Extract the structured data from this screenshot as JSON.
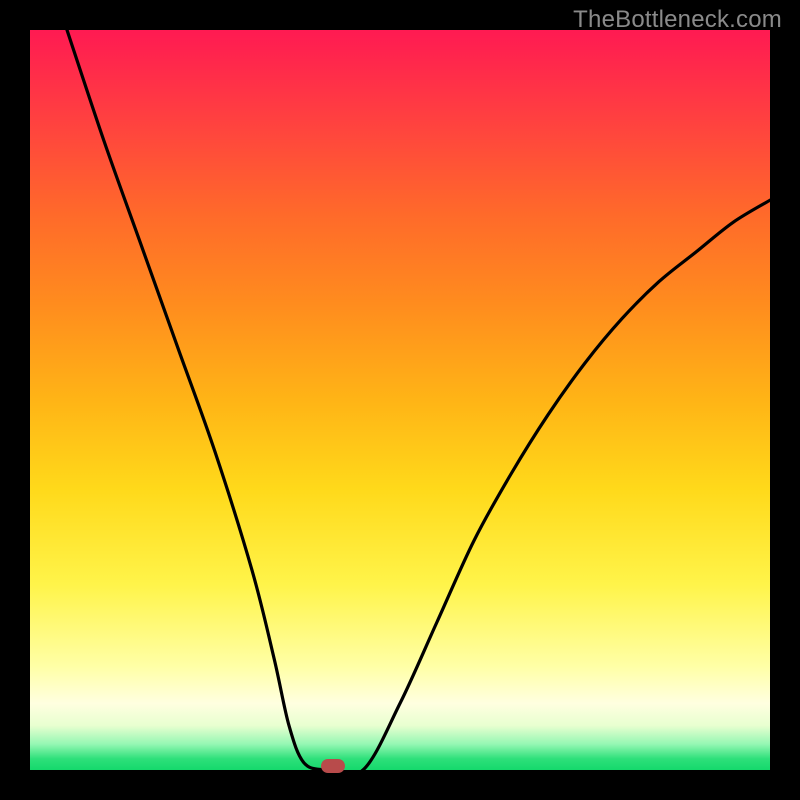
{
  "watermark": "TheBottleneck.com",
  "chart_data": {
    "type": "line",
    "title": "",
    "xlabel": "",
    "ylabel": "",
    "xlim": [
      0,
      100
    ],
    "ylim": [
      0,
      100
    ],
    "grid": false,
    "series": [
      {
        "name": "bottleneck-curve",
        "x": [
          5,
          10,
          15,
          20,
          25,
          30,
          33,
          35,
          37,
          40,
          45,
          50,
          55,
          60,
          65,
          70,
          75,
          80,
          85,
          90,
          95,
          100
        ],
        "y": [
          100,
          85,
          71,
          57,
          43,
          27,
          15,
          6,
          1,
          0,
          0,
          9,
          20,
          31,
          40,
          48,
          55,
          61,
          66,
          70,
          74,
          77
        ]
      }
    ],
    "marker": {
      "x": 41,
      "y": 0.5,
      "label": "optimal-point"
    },
    "background_gradient": {
      "top": "#ff1a52",
      "bottom": "#15d96c",
      "meaning": "red=high bottleneck, green=low bottleneck"
    }
  }
}
